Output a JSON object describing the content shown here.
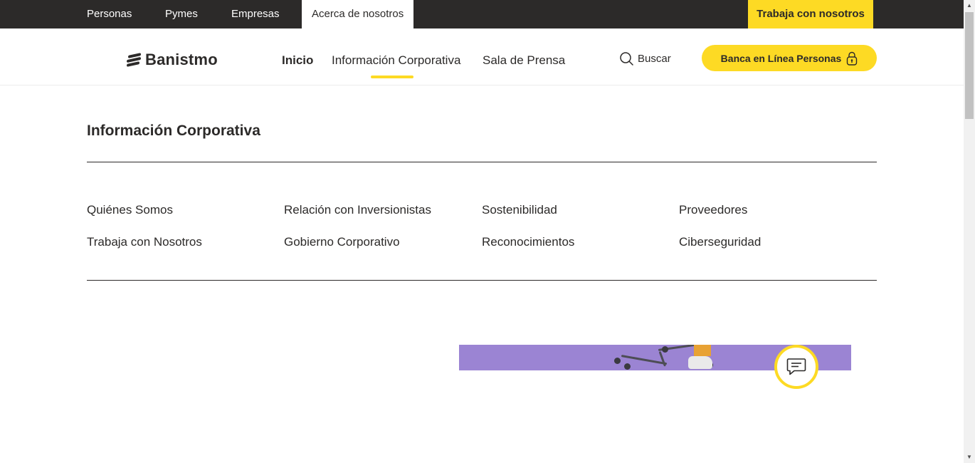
{
  "topbar": {
    "segments": [
      "Personas",
      "Pymes",
      "Empresas",
      "Acerca de nosotros"
    ],
    "work_label": "Trabaja con nosotros"
  },
  "header": {
    "logo": "Banistmo",
    "nav": [
      "Inicio",
      "Información Corporativa",
      "Sala de Prensa"
    ],
    "search_label": "Buscar",
    "online_banking_label": "Banca en Línea Personas"
  },
  "main": {
    "title": "Información Corporativa",
    "links": [
      "Quiénes Somos",
      "Relación con Inversionistas",
      "Sostenibilidad",
      "Proveedores",
      "Trabaja con Nosotros",
      "Gobierno Corporativo",
      "Reconocimientos",
      "Ciberseguridad"
    ]
  },
  "colors": {
    "brand_yellow": "#fdda24",
    "dark": "#2c2a29",
    "promo_purple": "#9b84d3"
  },
  "icons": [
    "search-icon",
    "lock-icon",
    "chat-icon",
    "scroll-up-arrow-icon",
    "scroll-down-arrow-icon"
  ]
}
